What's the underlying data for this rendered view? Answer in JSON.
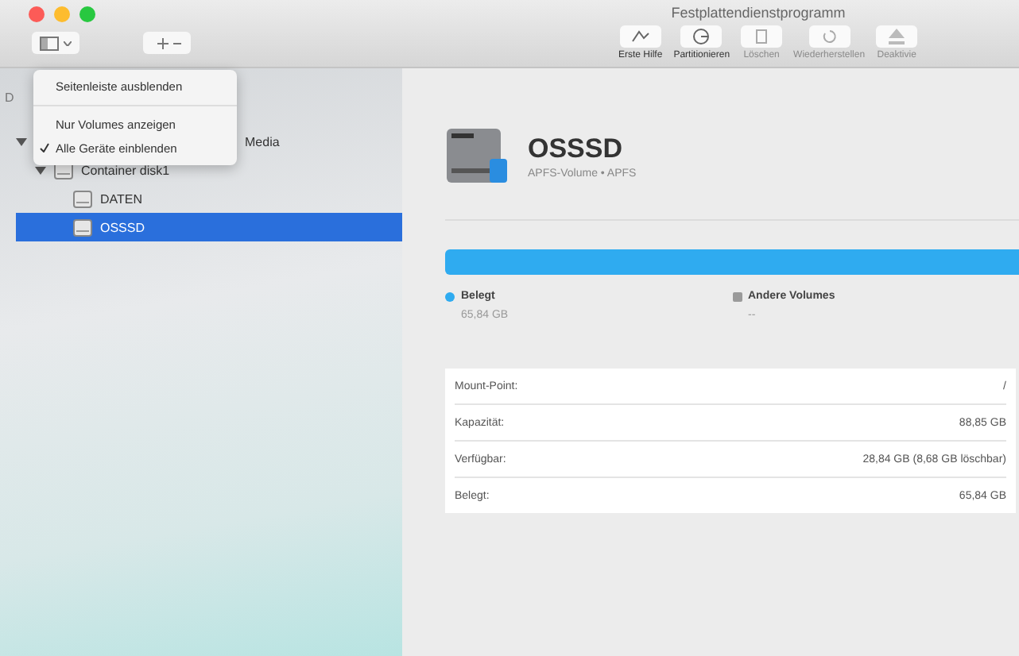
{
  "window": {
    "title": "Festplattendienstprogramm"
  },
  "toolbar": {
    "buttons": [
      {
        "label": "Erste Hilfe",
        "disabled": false
      },
      {
        "label": "Partitionieren",
        "disabled": false
      },
      {
        "label": "Löschen",
        "disabled": true
      },
      {
        "label": "Wiederherstellen",
        "disabled": true
      },
      {
        "label": "Deaktivie",
        "disabled": true
      }
    ]
  },
  "view_menu": {
    "items": [
      {
        "kind": "item",
        "label": "Seitenleiste ausblenden",
        "checked": false
      },
      {
        "kind": "separator"
      },
      {
        "kind": "item",
        "label": "Nur Volumes anzeigen",
        "checked": false
      },
      {
        "kind": "item",
        "label": "Alle Geräte einblenden",
        "checked": true
      }
    ]
  },
  "sidebar": {
    "heading": "D",
    "items": [
      {
        "label": "Media",
        "expanded": true,
        "selected": false,
        "children": [
          {
            "label": "Container disk1",
            "expanded": true,
            "selected": false,
            "children": [
              {
                "label": "DATEN",
                "selected": false
              },
              {
                "label": "OSSSD",
                "selected": true
              }
            ]
          }
        ]
      }
    ]
  },
  "volume": {
    "name": "OSSSD",
    "subtitle": "APFS-Volume • APFS"
  },
  "usage": {
    "level": 1,
    "legend": [
      {
        "label": "Belegt",
        "value": "65,84 GB",
        "color": "#2fabf0"
      },
      {
        "label": "Andere Volumes",
        "value": "--",
        "color": "#9a9a9a"
      }
    ]
  },
  "info": [
    {
      "label": "Mount-Point:",
      "value": "/"
    },
    {
      "label": "Kapazität:",
      "value": "88,85 GB"
    },
    {
      "label": "Verfügbar:",
      "value": "28,84 GB (8,68 GB löschbar)"
    },
    {
      "label": "Belegt:",
      "value": "65,84 GB"
    }
  ]
}
